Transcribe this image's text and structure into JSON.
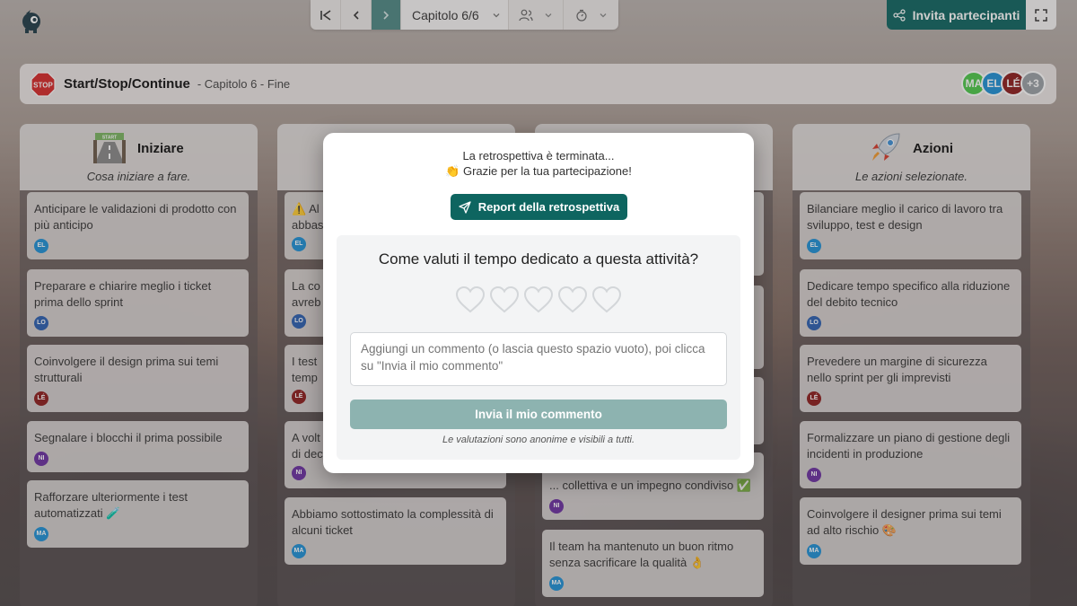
{
  "toolbar": {
    "chapter_label": "Capitolo 6/6",
    "invite_label": "Invita partecipanti"
  },
  "header": {
    "title": "Start/Stop/Continue",
    "subtitle": "- Capitolo 6 - Fine",
    "avatars": [
      {
        "initials": "MA",
        "color": "#4cc94a"
      },
      {
        "initials": "EL",
        "color": "#1e90d6"
      },
      {
        "initials": "LÉ",
        "color": "#8c1c1c"
      },
      {
        "initials": "+3",
        "color": "#9aa0a6"
      }
    ]
  },
  "columns": [
    {
      "title": "Iniziare",
      "subtitle": "Cosa iniziare a fare.",
      "cards": [
        {
          "text": "Anticipare le validazioni di prodotto con più anticipo",
          "author": "EL",
          "color": "#1e90d6"
        },
        {
          "text": "Preparare e chiarire meglio i ticket prima dello sprint",
          "author": "LO",
          "color": "#2b5fb0"
        },
        {
          "text": "Coinvolgere il design prima sui temi strutturali",
          "author": "LÉ",
          "color": "#8c1c1c"
        },
        {
          "text": "Segnalare i blocchi il prima possibile",
          "author": "NI",
          "color": "#6a2fa0"
        },
        {
          "text": "Rafforzare ulteriormente i test automatizzati 🧪",
          "author": "MA",
          "color": "#1e90d6"
        }
      ]
    },
    {
      "title": "",
      "subtitle": "",
      "cards": [
        {
          "text": "⚠️ Al",
          "text2": "abbas",
          "author": "EL",
          "color": "#1e90d6"
        },
        {
          "text": "La co",
          "text2": "avreb",
          "author": "LO",
          "color": "#2b5fb0"
        },
        {
          "text": "I test",
          "text2": "temp",
          "author": "LÉ",
          "color": "#8c1c1c"
        },
        {
          "text": "A volt",
          "text2": "di dec",
          "author": "NI",
          "color": "#6a2fa0"
        },
        {
          "text": "Abbiamo sottostimato la complessità di alcuni ticket",
          "author": "MA",
          "color": "#1e90d6"
        }
      ]
    },
    {
      "title": "",
      "subtitle": "",
      "cards": [
        {
          "text": "... collettiva e un impegno condiviso ✅",
          "author": "NI",
          "color": "#6a2fa0"
        },
        {
          "text": "Il team ha mantenuto un buon ritmo senza sacrificare la qualità 👌",
          "author": "MA",
          "color": "#1e90d6"
        }
      ]
    },
    {
      "title": "Azioni",
      "subtitle": "Le azioni selezionate.",
      "cards": [
        {
          "text": "Bilanciare meglio il carico di lavoro tra sviluppo, test e design",
          "author": "EL",
          "color": "#1e90d6"
        },
        {
          "text": "Dedicare tempo specifico alla riduzione del debito tecnico",
          "author": "LO",
          "color": "#2b5fb0"
        },
        {
          "text": "Prevedere un margine di sicurezza nello sprint per gli imprevisti",
          "author": "LÉ",
          "color": "#8c1c1c"
        },
        {
          "text": "Formalizzare un piano di gestione degli incidenti in produzione",
          "author": "NI",
          "color": "#6a2fa0"
        },
        {
          "text": "Coinvolgere il designer prima sui temi ad alto rischio 🎨",
          "author": "MA",
          "color": "#1e90d6"
        }
      ]
    }
  ],
  "modal": {
    "line1": "La retrospettiva è terminata...",
    "line2": "👏 Grazie per la tua partecipazione!",
    "report_label": "Report della retrospettiva",
    "question": "Come valuti il tempo dedicato a questa attività?",
    "rating": 0,
    "rating_max": 5,
    "comment_placeholder": "Aggiungi un commento (o lascia questo spazio vuoto), poi clicca su \"Invia il mio commento\"",
    "send_label": "Invia il mio commento",
    "note": "Le valutazioni sono anonime e visibili a tutti."
  }
}
